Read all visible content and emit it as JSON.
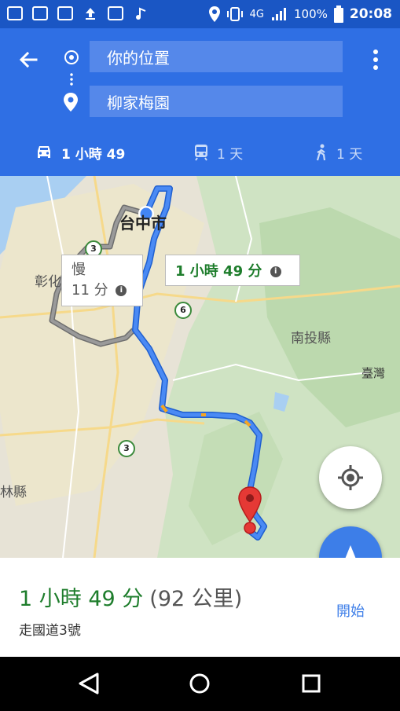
{
  "status_bar": {
    "signal_label": "4G",
    "battery": "100%",
    "time": "20:08"
  },
  "header": {
    "origin": "你的位置",
    "destination": "柳家梅園"
  },
  "modes": [
    {
      "icon": "car-icon",
      "label": "1 小時 49"
    },
    {
      "icon": "train-icon",
      "label": "1 天"
    },
    {
      "icon": "walk-icon",
      "label": "1 天"
    }
  ],
  "map": {
    "city": "台中市",
    "labels": [
      "彰化",
      "林縣",
      "南投縣",
      "臺灣"
    ],
    "highways": [
      "3",
      "6",
      "3"
    ],
    "callout_alt_line1": "慢",
    "callout_alt_line2": "11 分",
    "callout_main": "1 小時 49 分",
    "info_glyph": "i"
  },
  "summary": {
    "duration": "1 小時 49 分",
    "distance": "(92 公里)",
    "via": "走國道3號",
    "start": "開始"
  },
  "colors": {
    "header": "#2f6fe4",
    "status_bar": "#1a56c4",
    "route": "#4a8af4",
    "alt_route": "#8a8a8a",
    "duration_green": "#1e7d2c",
    "pin": "#e53935"
  }
}
